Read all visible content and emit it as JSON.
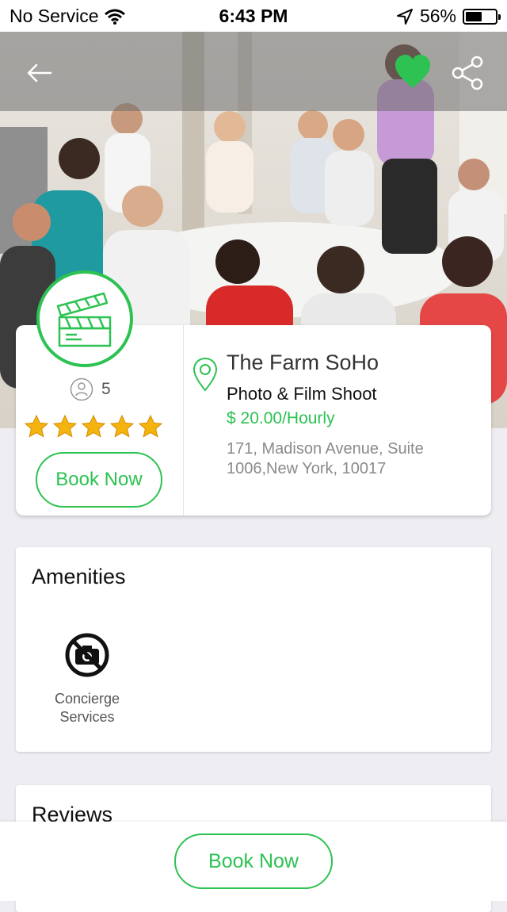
{
  "status_bar": {
    "carrier": "No Service",
    "time": "6:43 PM",
    "battery_percent": "56%",
    "battery_level": 0.56,
    "icons": [
      "wifi-icon",
      "location-arrow-icon",
      "battery-icon"
    ]
  },
  "nav": {
    "icons": [
      "back-arrow-icon",
      "heart-icon",
      "share-icon"
    ],
    "favorite_color": "#2dc252"
  },
  "hero": {
    "scene": "meeting-room-photo"
  },
  "venue": {
    "category_icon": "clapperboard-icon",
    "capacity": "5",
    "rating": 5,
    "rating_max": 5,
    "name": "The Farm SoHo",
    "type": "Photo & Film Shoot",
    "price": "$ 20.00/Hourly",
    "address": "171, Madison Avenue, Suite 1006,New York, 10017",
    "book_label": "Book Now"
  },
  "amenities": {
    "title": "Amenities",
    "items": [
      {
        "label": "Concierge Services",
        "icon": "no-camera-icon"
      }
    ]
  },
  "reviews": {
    "title": "Reviews"
  },
  "footer": {
    "book_label": "Book Now"
  },
  "colors": {
    "accent": "#2dc252",
    "star": "#f5b30f",
    "price": "#2dc252"
  }
}
